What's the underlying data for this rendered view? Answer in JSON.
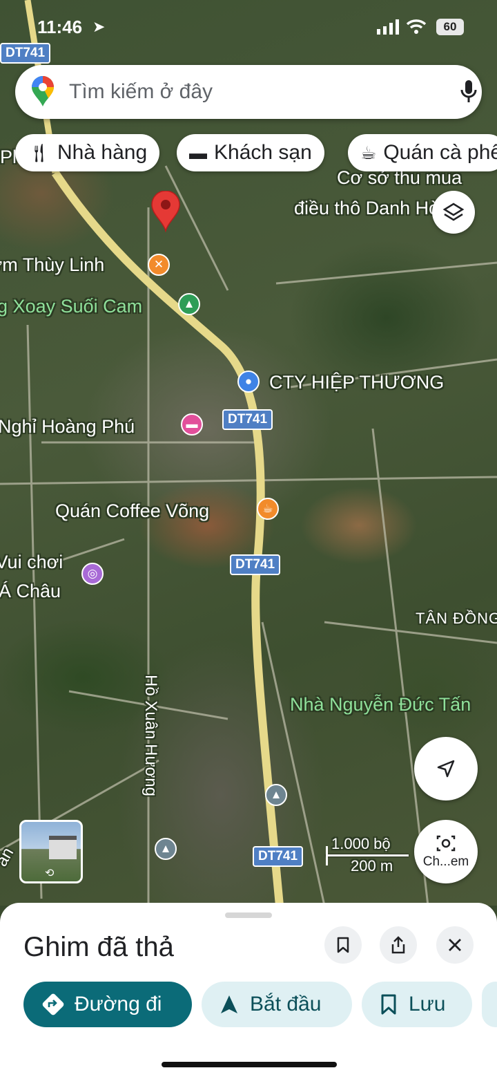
{
  "status_bar": {
    "time": "11:46",
    "battery": "60"
  },
  "search": {
    "placeholder": "Tìm kiếm ở đây"
  },
  "chips": [
    {
      "icon": "restaurant-icon",
      "label": "Nhà hàng"
    },
    {
      "icon": "hotel-icon",
      "label": "Khách sạn"
    },
    {
      "icon": "coffee-icon",
      "label": "Quán cà phê"
    }
  ],
  "map": {
    "road_shields": [
      "DT741",
      "DT741",
      "DT741",
      "DT741"
    ],
    "labels": {
      "co_so_line1": "Cơ sở thu mua",
      "co_so_line2": "điều thô Danh Hòa",
      "thuy_linh": "Cơm Thùy Linh",
      "suoi_cam": "Vòng Xoay Suối Cam",
      "hiep_thuong": "CTY HIỆP THƯƠNG",
      "hoang_phu": "Nhà Nghỉ Hoàng Phú",
      "coffee_vong": "Quán Coffee Võng",
      "vui_choi_line1": "Khu Vui chơi",
      "vui_choi_line2": "Á Châu",
      "tan_dong": "TÂN ĐỒNG",
      "nguyen_duc": "Nhà Nguyễn Đức Tấn",
      "ho_xuan_huong": "Hồ Xuân Hương",
      "partial_left_top": "Pl",
      "partial_left_bottom": "an"
    },
    "scale": {
      "imperial": "1.000 bộ",
      "metric": "200 m"
    },
    "camera_label": "Ch...em"
  },
  "sheet": {
    "title": "Ghim đã thả",
    "actions": [
      {
        "icon": "directions-icon",
        "label": "Đường đi"
      },
      {
        "icon": "navigation-arrow-icon",
        "label": "Bắt đầu"
      },
      {
        "icon": "bookmark-icon",
        "label": "Lưu"
      }
    ]
  },
  "colors": {
    "accent": "#0b6b78",
    "chip_bg": "#dff0f3",
    "pin": "#e53935",
    "road": "#e6d98a"
  }
}
